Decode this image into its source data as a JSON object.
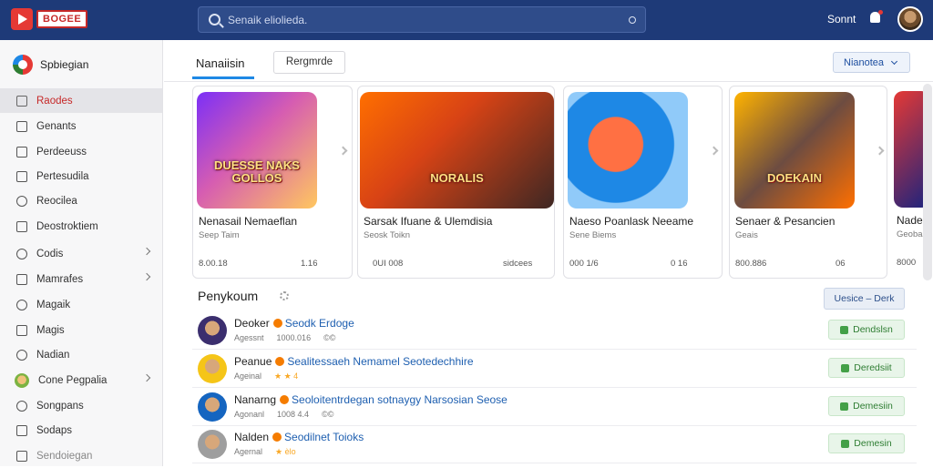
{
  "app": {
    "logo_text": "BOGEE"
  },
  "search": {
    "placeholder": "Senaik eliolieda."
  },
  "header": {
    "signin_label": "Sonnt"
  },
  "sidebar": {
    "brand": "Spbiegian",
    "items": [
      {
        "label": "Raodes",
        "icon": "grid-icon",
        "active": true,
        "chevron": false
      },
      {
        "label": "Genants",
        "icon": "list-icon",
        "active": false,
        "chevron": false
      },
      {
        "label": "Perdeeuss",
        "icon": "table-icon",
        "active": false,
        "chevron": false
      },
      {
        "label": "Pertesudila",
        "icon": "table-icon",
        "active": false,
        "chevron": false
      },
      {
        "label": "Reocilea",
        "icon": "gear-icon",
        "active": false,
        "chevron": false
      },
      {
        "label": "Deostroktiem",
        "icon": "bag-icon",
        "active": false,
        "chevron": false
      },
      {
        "label": "Codis",
        "icon": "chat-icon",
        "active": false,
        "chevron": true
      },
      {
        "label": "Mamrafes",
        "icon": "book-icon",
        "active": false,
        "chevron": true
      },
      {
        "label": "Magaik",
        "icon": "magic-icon",
        "active": false,
        "chevron": false
      },
      {
        "label": "Magis",
        "icon": "chart-icon",
        "active": false,
        "chevron": false
      },
      {
        "label": "Nadian",
        "icon": "sparkle-icon",
        "active": false,
        "chevron": false
      },
      {
        "label": "Cone Pegpalia",
        "icon": "avatar-icon",
        "active": false,
        "chevron": true
      },
      {
        "label": "Songpans",
        "icon": "chat-icon",
        "active": false,
        "chevron": false
      },
      {
        "label": "Sodaps",
        "icon": "list-icon",
        "active": false,
        "chevron": false
      },
      {
        "label": "Sendoiegan",
        "icon": "grid-icon",
        "active": false,
        "chevron": false
      }
    ]
  },
  "main": {
    "tabs": [
      {
        "label": "Nanaiisin"
      },
      {
        "label": "Rergmrde"
      }
    ],
    "filter_label": "Nianotea",
    "cards": [
      {
        "title": "Nenasail Nemaeflan",
        "sub": "Seep Taim",
        "stat_left": "8.00.18",
        "stat_right": "1.16",
        "thumb_text": "DUESSE NAKS GOLLOS"
      },
      {
        "title": "Sarsak Ifuane & Ulemdisia",
        "sub": "Seosk Toikn",
        "stat_left": "0UI 008",
        "stat_right": "sidcees",
        "thumb_text": "NORALIS"
      },
      {
        "title": "Naeso Poanlask Neeame",
        "sub": "Sene Biems",
        "stat_left": "000 1/6",
        "stat_right": "0 16",
        "thumb_text": ""
      },
      {
        "title": "Senaer & Pesancien",
        "sub": "Geais",
        "stat_left": "800.886",
        "stat_right": "06",
        "thumb_text": "DOEKAIN"
      },
      {
        "title": "Nade",
        "sub": "Geobas",
        "stat_left": "8000",
        "stat_right": "",
        "thumb_text": ""
      }
    ],
    "section": {
      "title": "Penykoum",
      "sort_label": "Uesice – Derk"
    },
    "rows": [
      {
        "name": "Deoker",
        "link": "Seodk Erdoge",
        "meta_left": "Agessnt",
        "meta_mid": "1000.016",
        "meta_right": "©©",
        "button": "Dendslsn",
        "avatar": "#3b2e6e"
      },
      {
        "name": "Peanue",
        "link": "Sealitessaeh Nemamel Seotedechhire",
        "meta_left": "Ageinal",
        "meta_mid": "★ ★ 4",
        "meta_right": "",
        "button": "Deredsiit",
        "avatar": "#f5c518"
      },
      {
        "name": "Nanarng",
        "link": "Seoloitentrdegan sotnaygy Narsosian Seose",
        "meta_left": "Agonanl",
        "meta_mid": "1008 4.4",
        "meta_right": "©©",
        "button": "Demesiin",
        "avatar": "#1565c0"
      },
      {
        "name": "Nalden",
        "link": "Seodilnet Toioks",
        "meta_left": "Agernal",
        "meta_mid": "★ èlo",
        "meta_right": "",
        "button": "Demesin",
        "avatar": "#9e9e9e"
      }
    ]
  }
}
